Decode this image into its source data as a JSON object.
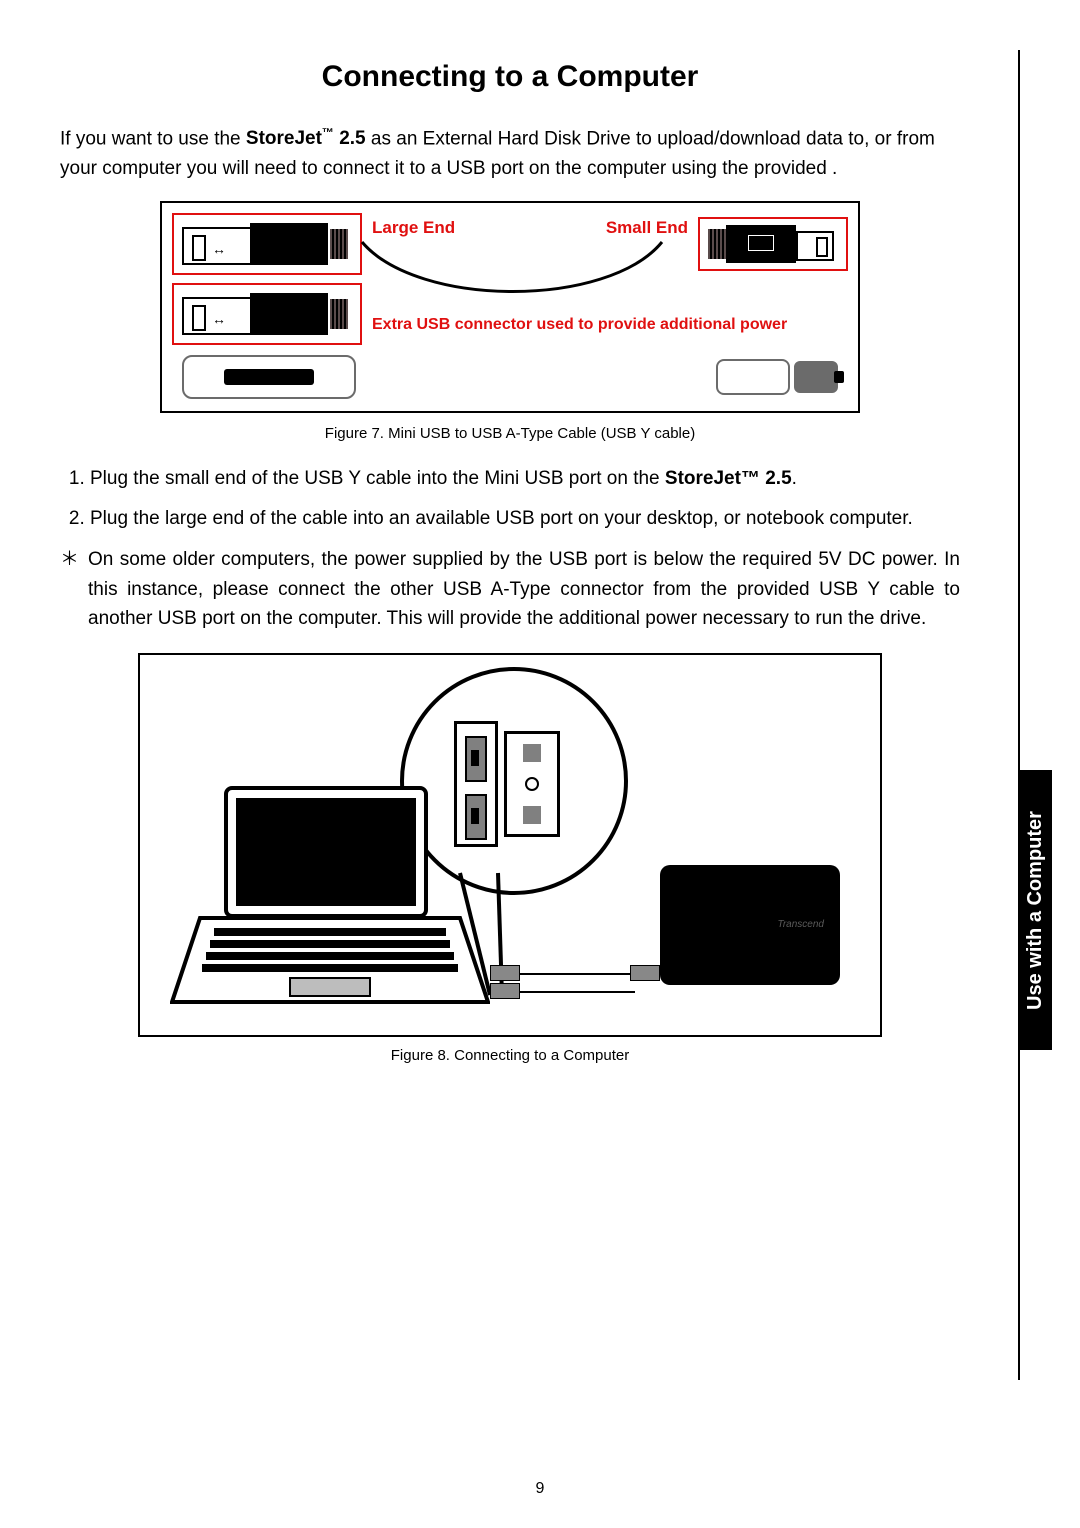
{
  "title": "Connecting to a Computer",
  "intro": {
    "prefix": "If you want to use the ",
    "product_bold": "StoreJet",
    "product_tm": "™",
    "product_suffix_bold": " 2.5",
    "rest": " as an External Hard Disk Drive to upload/download data to, or from your computer you will need to connect it to a USB port on the computer using the provided   ."
  },
  "fig7": {
    "large_end": "Large End",
    "small_end": "Small End",
    "extra_power": "Extra USB connector used to provide additional power",
    "caption": "Figure 7. Mini USB to USB A-Type Cable (USB Y cable)"
  },
  "steps": {
    "s1_prefix": "Plug the small end of the USB Y cable into the Mini USB port on the ",
    "s1_bold": "StoreJet",
    "s1_tm": "™",
    "s1_suffix_bold": " 2.5",
    "s1_end": ".",
    "s2": "Plug the large end of the cable into an available USB port on your desktop, or notebook computer.",
    "star_symbol": "＊",
    "star": "On some older computers, the power supplied by the USB port is below the required 5V DC power. In this instance, please connect the other USB A-Type connector from the provided USB Y cable to another USB port on the computer. This will provide the additional power necessary to run the drive."
  },
  "fig8": {
    "caption": "Figure 8. Connecting to a Computer",
    "drive_label": "Transcend"
  },
  "side_tab": "Use with a Computer",
  "page_number": "9"
}
